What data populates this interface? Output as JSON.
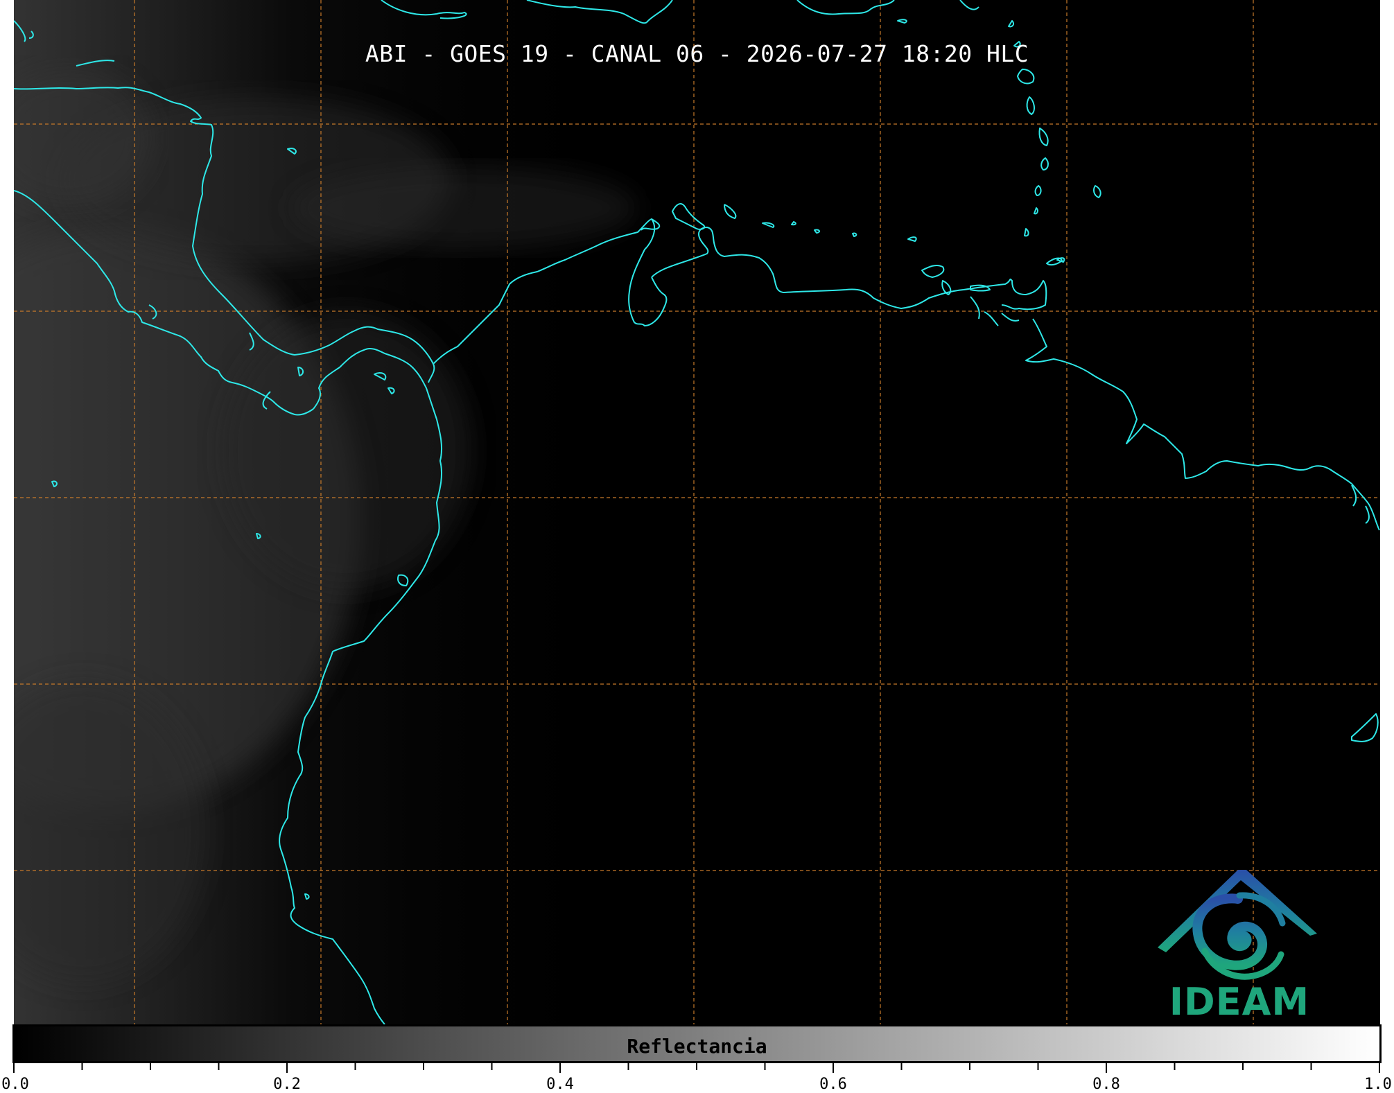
{
  "map": {
    "title": "ABI - GOES 19 - CANAL 06 - 2026-07-27 18:20 HLC",
    "coastline_color": "#2ee8e8",
    "grid_color": "#c87a2a",
    "background_color": "#000000"
  },
  "logo": {
    "text": "IDEAM",
    "icon": "ideam-swirl-icon",
    "color": "#1fa67c"
  },
  "colorbar": {
    "label": "Reflectancia",
    "min": 0.0,
    "max": 1.0,
    "tick_labels": [
      "0.0",
      "0.2",
      "0.4",
      "0.6",
      "0.8",
      "1.0"
    ],
    "colormap": "gray"
  }
}
